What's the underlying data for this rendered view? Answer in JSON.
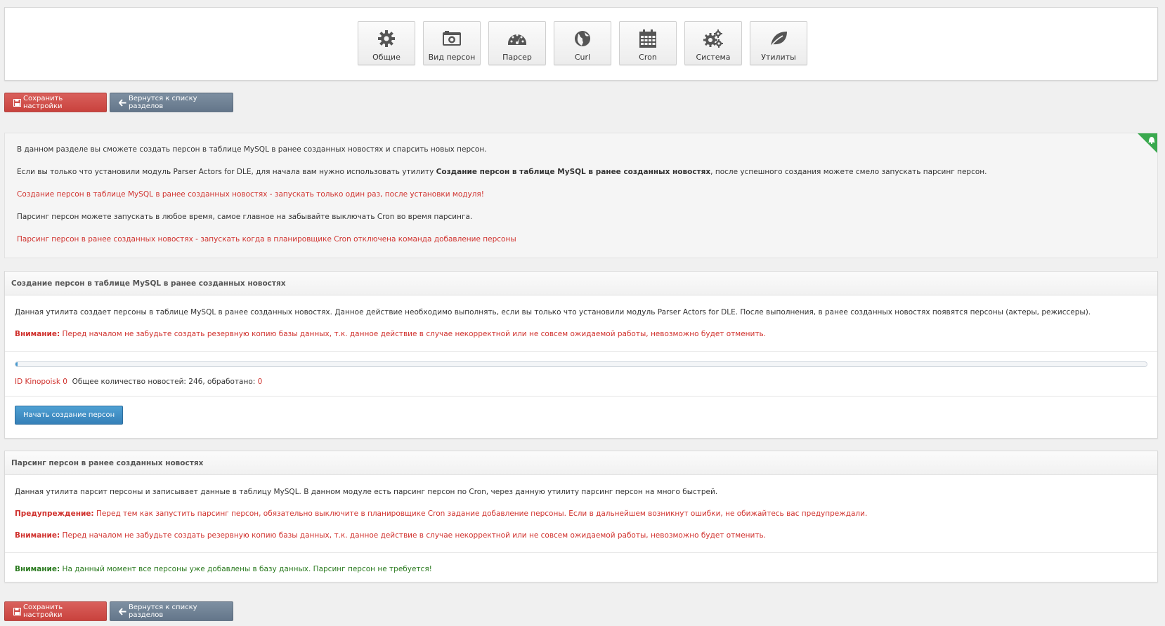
{
  "nav": {
    "tiles": [
      {
        "label": "Общие",
        "icon": "gear-icon"
      },
      {
        "label": "Вид персон",
        "icon": "camera-icon"
      },
      {
        "label": "Парсер",
        "icon": "dashboard-icon"
      },
      {
        "label": "Curl",
        "icon": "globe-icon"
      },
      {
        "label": "Cron",
        "icon": "calendar-icon"
      },
      {
        "label": "Система",
        "icon": "gears-icon"
      },
      {
        "label": "Утилиты",
        "icon": "leaf-icon"
      }
    ]
  },
  "toolbar": {
    "save_label": "Сохранить настройки",
    "back_label": "Вернутся к списку разделов"
  },
  "info": {
    "p1": "В данном разделе вы сможете создать персон в таблице MySQL в ранее созданных новостях и спарсить новых персон.",
    "p2_before": "Если вы только что установили модуль Parser Actors for DLE, для начала вам нужно использовать утилиту ",
    "p2_bold": "Создание персон в таблице MySQL в ранее созданных новостях",
    "p2_after": ", после успешного создания можете смело запускать парсинг персон.",
    "p3": "Создание персон в таблице MySQL в ранее созданных новостях - запускать только один раз, после установки модуля!",
    "p4": "Парсинг персон можете запускать в любое время, самое главное на забывайте выключать Cron во время парсинга.",
    "p5": "Парсинг персон в ранее созданных новостях - запускать когда в планировщике Cron отключена команда добавление персоны"
  },
  "create_section": {
    "title": "Создание персон в таблице MySQL в ранее созданных новостях",
    "description": "Данная утилита создает персоны в таблице MySQL в ранее созданных новостях. Данное действие необходимо выполнять, если вы только что установили модуль Parser Actors for DLE. После выполнения, в ранее созданных новостях появятся персоны (актеры, режиссеры).",
    "warning_label": "Внимание:",
    "warning_text": " Перед началом не забудьте создать резервную копию базы данных, т.к. данное действие в случае некорректной или не совсем ожидаемой работы, невозможно будет отменить.",
    "progress_fraction": 0.002,
    "stats_id": "ID Kinopoisk 0",
    "stats_text": "  Общее количество новостей: 246, обработано: ",
    "stats_processed": "0",
    "start_button": "Начать создание персон"
  },
  "parse_section": {
    "title": "Парсинг персон в ранее созданных новостях",
    "description": "Данная утилита парсит персоны и записывает данные в таблицу MySQL. В данном модуле есть парсинг персон по Cron, через данную утилиту парсинг персон на много быстрей.",
    "notice_label": "Предупреждение:",
    "notice_text": " Перед тем как запустить парсинг персон, обязательно выключите в планировщике Cron задание добавление персоны. Если в дальнейшем возникнут ошибки, не обижайтесь вас предупреждали.",
    "warning_label": "Внимание:",
    "warning_text": " Перед началом не забудьте создать резервную копию базы данных, т.к. данное действие в случае некорректной или не совсем ожидаемой работы, невозможно будет отменить.",
    "status_label": "Внимание:",
    "status_text": " На данный момент все персоны уже добавлены в базу данных. Парсинг персон не требуется!"
  },
  "colors": {
    "save_button": "#c9423d",
    "back_button": "#64768a",
    "start_button": "#3680b8",
    "warning_text": "#d0312d",
    "success_text": "#2a7a1f",
    "corner_badge": "#3aa94e"
  }
}
